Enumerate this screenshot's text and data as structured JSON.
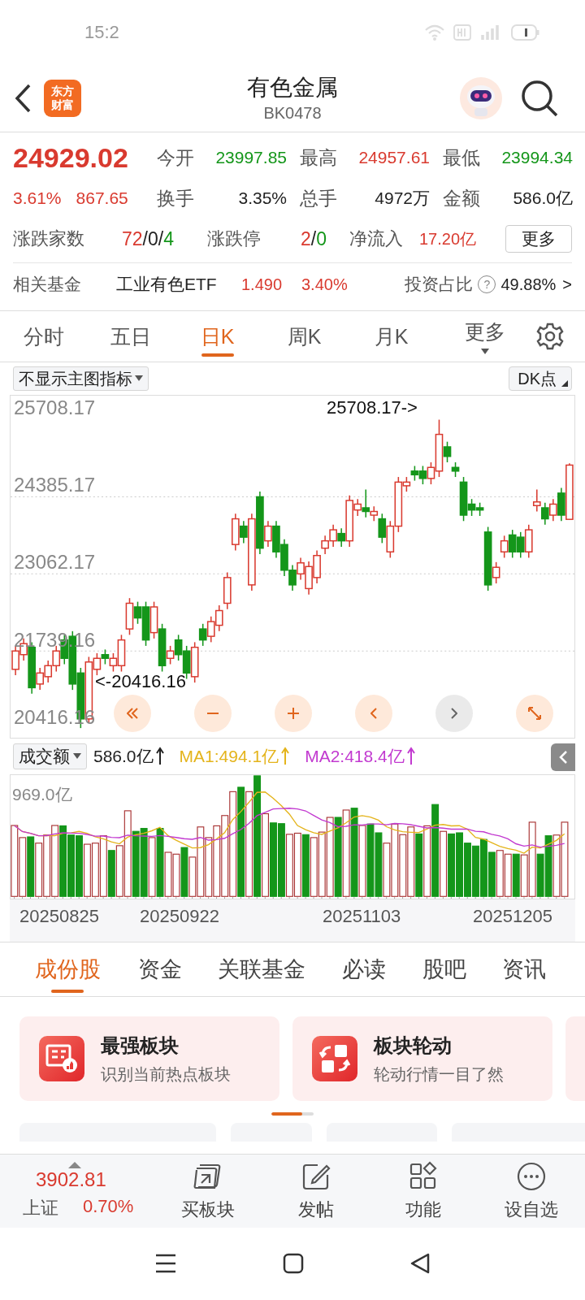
{
  "status_bar": {
    "time": "15:2"
  },
  "header": {
    "logo_lines": [
      "东方",
      "财富"
    ],
    "title": "有色金属",
    "code": "BK0478"
  },
  "quote": {
    "price": "24929.02",
    "change_pct": "3.61%",
    "change": "867.65",
    "stats": [
      {
        "label": "今开",
        "value": "23997.85",
        "color": "#14961a"
      },
      {
        "label": "最高",
        "value": "24957.61",
        "color": "#d93a2f"
      },
      {
        "label": "最低",
        "value": "23994.34",
        "color": "#14961a"
      },
      {
        "label": "换手",
        "value": "3.35%",
        "color": "#222222"
      },
      {
        "label": "总手",
        "value": "4972万",
        "color": "#222222"
      },
      {
        "label": "金额",
        "value": "586.0亿",
        "color": "#222222"
      }
    ],
    "breadth": {
      "label": "涨跌家数",
      "values": [
        "72",
        "0",
        "4"
      ],
      "separator": "/"
    },
    "limit": {
      "label": "涨跌停",
      "values": [
        "2",
        "0"
      ],
      "separator": "/"
    },
    "inflow": {
      "label": "净流入",
      "value": "17.20亿"
    },
    "more_button": "更多"
  },
  "fund": {
    "label": "相关基金",
    "name": "工业有色ETF",
    "price": "1.490",
    "pct": "3.40%",
    "ratio_label": "投资占比",
    "help": "?",
    "ratio": "49.88%",
    "arrow": ">"
  },
  "chart_tabs": [
    {
      "label": "分时",
      "selected": false
    },
    {
      "label": "五日",
      "selected": false
    },
    {
      "label": "日K",
      "selected": true
    },
    {
      "label": "周K",
      "selected": false
    },
    {
      "label": "月K",
      "selected": false
    }
  ],
  "more_tab": "更多",
  "indicator_select": "不显示主图指标",
  "dk_button": "DK点",
  "main_chart": {
    "chart_data": {
      "type": "candlestick",
      "ohlc": [
        [
          21424,
          21827,
          21323,
          21739
        ],
        [
          21676,
          21953,
          21575,
          21865
        ],
        [
          21802,
          21890,
          21008,
          21109
        ],
        [
          21172,
          21449,
          21071,
          21361
        ],
        [
          21298,
          21575,
          21197,
          21487
        ],
        [
          21487,
          21827,
          21386,
          21739
        ],
        [
          21928,
          22016,
          21512,
          21613
        ],
        [
          21991,
          22079,
          21071,
          21172
        ],
        [
          21361,
          21449,
          20416.16,
          20573
        ],
        [
          20573,
          21638,
          20504,
          21550
        ],
        [
          21424,
          21701,
          21323,
          21613
        ],
        [
          21676,
          21764,
          21512,
          21613
        ],
        [
          21487,
          21701,
          21386,
          21613
        ],
        [
          21487,
          22016,
          21386,
          21928
        ],
        [
          22117,
          22646,
          22016,
          22558
        ],
        [
          22495,
          22584,
          22205,
          22306
        ],
        [
          22495,
          22584,
          21827,
          21928
        ],
        [
          22054,
          22584,
          21953,
          22495
        ],
        [
          22117,
          22205,
          21386,
          21487
        ],
        [
          21613,
          21827,
          21512,
          21739
        ],
        [
          21928,
          22016,
          21575,
          21676
        ],
        [
          21739,
          21827,
          21260,
          21361
        ],
        [
          21298,
          21890,
          21197,
          21802
        ],
        [
          22117,
          22205,
          21827,
          21928
        ],
        [
          21991,
          22331,
          21890,
          22243
        ],
        [
          22180,
          22521,
          22079,
          22432
        ],
        [
          22558,
          23087,
          22457,
          22999
        ],
        [
          23566,
          24095,
          23465,
          24007
        ],
        [
          23881,
          23969,
          23591,
          23692
        ],
        [
          22873,
          24095,
          22772,
          24007
        ],
        [
          24385,
          24473,
          23402,
          23503
        ],
        [
          23629,
          23969,
          23528,
          23881
        ],
        [
          23881,
          23969,
          23339,
          23440
        ],
        [
          23566,
          23654,
          23024,
          23125
        ],
        [
          23125,
          23213,
          22772,
          22873
        ],
        [
          23062,
          23339,
          22961,
          23251
        ],
        [
          22810,
          23276,
          22709,
          23188
        ],
        [
          22999,
          23465,
          22898,
          23377
        ],
        [
          23503,
          23717,
          23402,
          23629
        ],
        [
          23629,
          23906,
          23528,
          23818
        ],
        [
          23755,
          23843,
          23528,
          23629
        ],
        [
          23629,
          24410,
          23528,
          24322
        ],
        [
          24158,
          24347,
          24057,
          24259
        ],
        [
          24196,
          24511,
          24032,
          24133
        ],
        [
          24070,
          24221,
          23969,
          24133
        ],
        [
          24007,
          24095,
          23591,
          23692
        ],
        [
          23440,
          23969,
          23339,
          23881
        ],
        [
          23881,
          24725,
          23780,
          24637
        ],
        [
          24574,
          24725,
          24473,
          24637
        ],
        [
          24826,
          24914,
          24662,
          24763
        ],
        [
          24826,
          24914,
          24599,
          24700
        ],
        [
          24700,
          24977,
          24599,
          24889
        ],
        [
          24826,
          25708.17,
          24725,
          25456
        ],
        [
          25242,
          25330,
          24977,
          25078
        ],
        [
          24889,
          24977,
          24725,
          24826
        ],
        [
          24637,
          24725,
          23969,
          24070
        ],
        [
          24259,
          24347,
          24057,
          24158
        ],
        [
          24196,
          24284,
          24057,
          24158
        ],
        [
          23780,
          23868,
          22772,
          22873
        ],
        [
          22999,
          23264,
          22898,
          23175
        ],
        [
          23440,
          23717,
          23339,
          23629
        ],
        [
          23730,
          23818,
          23339,
          23440
        ],
        [
          23692,
          23780,
          23339,
          23440
        ],
        [
          23440,
          23906,
          23339,
          23818
        ],
        [
          24234,
          24511,
          24133,
          24297
        ],
        [
          24196,
          24284,
          23906,
          24007
        ],
        [
          24070,
          24347,
          23969,
          24259
        ],
        [
          24448,
          24536,
          23969,
          24070
        ],
        [
          23997.85,
          24957.61,
          23994.34,
          24929.02
        ]
      ],
      "yticks": [
        25708.17,
        24385.17,
        23062.17,
        21739.16,
        20416.16
      ],
      "ylim": [
        20250,
        26120
      ],
      "grid": true,
      "annotations": [
        "25708.17->",
        "<-20416.16"
      ]
    },
    "controls": [
      {
        "kind": "rewind",
        "disabled": false
      },
      {
        "kind": "zoom_out",
        "disabled": false
      },
      {
        "kind": "zoom_in",
        "disabled": false
      },
      {
        "kind": "previous",
        "disabled": false
      },
      {
        "kind": "next",
        "disabled": true
      },
      {
        "kind": "fullscreen",
        "disabled": false
      }
    ]
  },
  "volume": {
    "selector": "成交额",
    "value": "586.0亿",
    "ma1": "MA1:494.1亿",
    "ma2": "MA2:418.4亿",
    "max_label": "969.0亿",
    "dates": [
      "20250825",
      "20250922",
      "20251103",
      "20251205"
    ]
  },
  "info_tabs": [
    {
      "label": "成份股",
      "selected": true
    },
    {
      "label": "资金",
      "selected": false
    },
    {
      "label": "关联基金",
      "selected": false
    },
    {
      "label": "必读",
      "selected": false
    },
    {
      "label": "股吧",
      "selected": false
    },
    {
      "label": "资讯",
      "selected": false
    }
  ],
  "cards": [
    {
      "title": "最强板块",
      "subtitle": "识别当前热点板块",
      "kind": "board"
    },
    {
      "title": "板块轮动",
      "subtitle": "轮动行情一目了然",
      "kind": "rotate"
    }
  ],
  "bottom_bar": {
    "index": {
      "value": "3902.81",
      "name": "上证",
      "pct": "0.70%"
    },
    "actions": [
      {
        "label": "买板块",
        "kind": "buy"
      },
      {
        "label": "发帖",
        "kind": "post"
      },
      {
        "label": "功能",
        "kind": "apps"
      },
      {
        "label": "设自选",
        "kind": "add"
      }
    ]
  }
}
